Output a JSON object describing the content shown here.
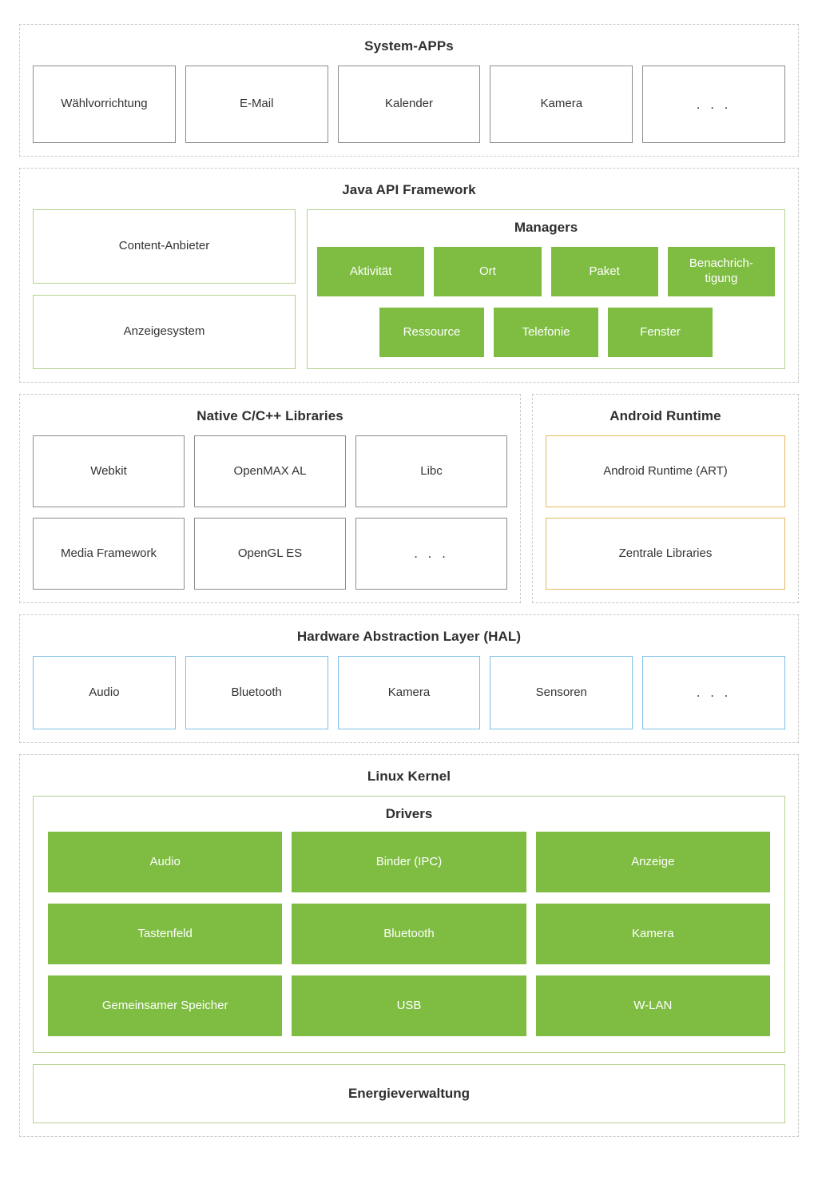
{
  "diagram": {
    "title": "Android Platform Architecture (German)",
    "colors": {
      "solid_green": "#7fbd42",
      "green_outline": "#b3d18e",
      "orange_outline": "#e7b85c",
      "blue_outline": "#7dc0e6",
      "gray_outline": "#8d8d8d",
      "dashed_border": "#c9c9c9",
      "text": "#333333"
    }
  },
  "layers": {
    "system_apps": {
      "title": "System-APPs",
      "items": [
        "Wählvorrichtung",
        "E-Mail",
        "Kalender",
        "Kamera",
        ". . ."
      ]
    },
    "java_api_framework": {
      "title": "Java API Framework",
      "left_items": [
        "Content-Anbieter",
        "Anzeigesystem"
      ],
      "managers": {
        "title": "Managers",
        "row1": [
          "Aktivität",
          "Ort",
          "Paket",
          "Benachrich-\ntigung"
        ],
        "row2": [
          "Ressource",
          "Telefonie",
          "Fenster"
        ]
      }
    },
    "native_libraries": {
      "title": "Native C/C++ Libraries",
      "row1": [
        "Webkit",
        "OpenMAX AL",
        "Libc"
      ],
      "row2": [
        "Media Framework",
        "OpenGL ES",
        ". . ."
      ]
    },
    "android_runtime": {
      "title": "Android Runtime",
      "items": [
        "Android Runtime (ART)",
        "Zentrale Libraries"
      ]
    },
    "hal": {
      "title": "Hardware Abstraction Layer (HAL)",
      "items": [
        "Audio",
        "Bluetooth",
        "Kamera",
        "Sensoren",
        ". . ."
      ]
    },
    "linux_kernel": {
      "title": "Linux Kernel",
      "drivers": {
        "title": "Drivers",
        "row1": [
          "Audio",
          "Binder (IPC)",
          "Anzeige"
        ],
        "row2": [
          "Tastenfeld",
          "Bluetooth",
          "Kamera"
        ],
        "row3": [
          "Gemeinsamer Speicher",
          "USB",
          "W-LAN"
        ]
      },
      "power_management": "Energieverwaltung"
    }
  }
}
